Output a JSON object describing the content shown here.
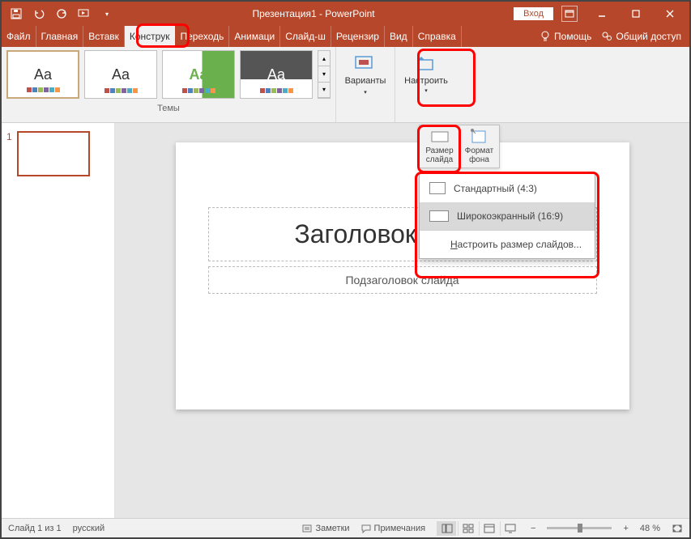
{
  "titlebar": {
    "title": "Презентация1 - PowerPoint",
    "signin": "Вход"
  },
  "tabs": {
    "file": "Файл",
    "home": "Главная",
    "insert": "Вставк",
    "design": "Конструк",
    "transitions": "Переходь",
    "animations": "Анимаци",
    "slideshow": "Слайд-ш",
    "review": "Рецензир",
    "view": "Вид",
    "help": "Справка",
    "tell_me": "Помощь",
    "share": "Общий доступ"
  },
  "ribbon": {
    "themes_label": "Темы",
    "variants_label": "Варианты",
    "customize_label": "Настроить"
  },
  "size_panel": {
    "slide_size": "Размер слайда",
    "format_bg": "Формат фона"
  },
  "size_menu": {
    "standard": "Стандартный (4:3)",
    "widescreen": "Широкоэкранный (16:9)",
    "custom_pre": "Н",
    "custom_post": "астроить размер слайдов..."
  },
  "slide": {
    "number": "1",
    "title_placeholder": "Заголовок слайда",
    "subtitle_placeholder": "Подзаголовок слайда"
  },
  "statusbar": {
    "slide_indicator": "Слайд 1 из 1",
    "language": "русский",
    "notes": "Заметки",
    "comments": "Примечания",
    "zoom": "48 %"
  },
  "colors": {
    "brand": "#B7472A"
  }
}
